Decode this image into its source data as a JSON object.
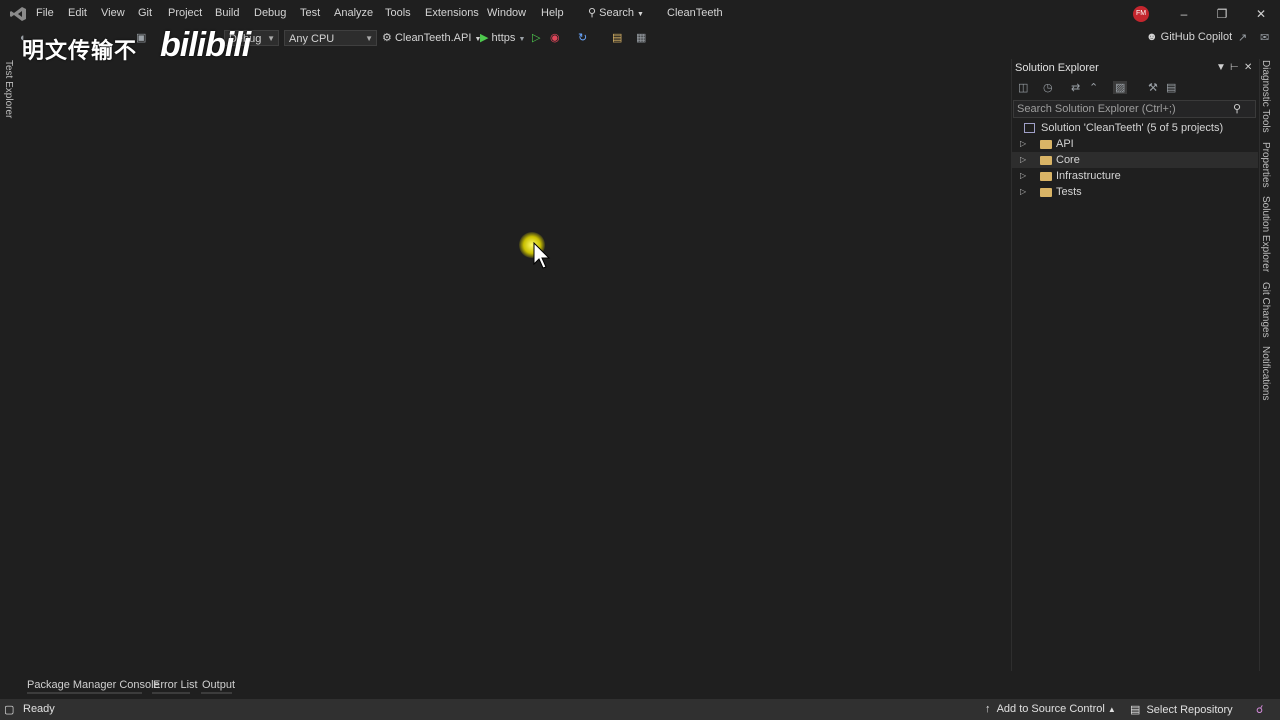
{
  "menubar": {
    "items": [
      "File",
      "Edit",
      "View",
      "Git",
      "Project",
      "Build",
      "Debug",
      "Test",
      "Analyze",
      "Tools",
      "Extensions",
      "Window",
      "Help"
    ],
    "search_label": "Search",
    "app_title": "CleanTeeth",
    "avatar_initials": "FM"
  },
  "toolbar": {
    "config_value": "Debug",
    "platform_value": "Any CPU",
    "startup_project": "CleanTeeth.API",
    "launch_profile": "https",
    "copilot_label": "GitHub Copilot"
  },
  "watermark": {
    "cn_text": "明文传输不",
    "brand": "bilibili"
  },
  "left_tabs": {
    "test_explorer": "Test Explorer"
  },
  "solution_explorer": {
    "title": "Solution Explorer",
    "search_placeholder": "Search Solution Explorer (Ctrl+;)",
    "solution_label": "Solution 'CleanTeeth' (5 of 5 projects)",
    "folders": [
      {
        "label": "API",
        "selected": false
      },
      {
        "label": "Core",
        "selected": true
      },
      {
        "label": "Infrastructure",
        "selected": false
      },
      {
        "label": "Tests",
        "selected": false
      }
    ]
  },
  "right_tabs": {
    "diagnostic_tools": "Diagnostic Tools",
    "properties": "Properties",
    "solution_explorer": "Solution Explorer",
    "git_changes": "Git Changes",
    "notifications": "Notifications"
  },
  "bottom_tabs": [
    "Package Manager Console",
    "Error List",
    "Output"
  ],
  "statusbar": {
    "status": "Ready",
    "add_to_source": "Add to Source Control",
    "select_repo": "Select Repository"
  },
  "colors": {
    "background": "#1f1f1f",
    "statusbar": "#303030",
    "folder": "#d9b466",
    "play": "#4ec94e"
  }
}
